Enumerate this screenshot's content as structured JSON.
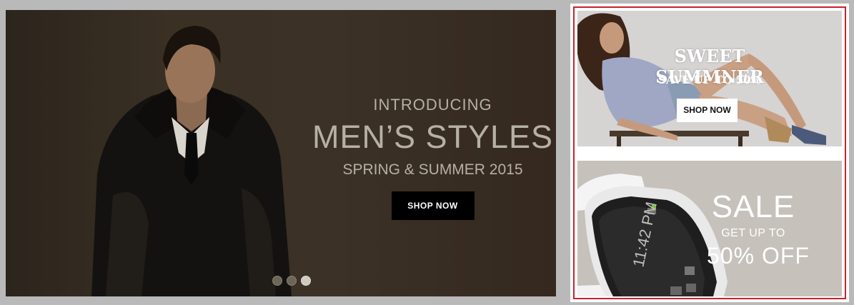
{
  "hero": {
    "intro": "INTRODUCING",
    "title": "MEN’S STYLES",
    "subtitle": "SPRING & SUMMER 2015",
    "button": "SHOP NOW",
    "slides": 3,
    "active_slide": 3
  },
  "promo_summer": {
    "title": "SWEET SUMMNER",
    "subtitle": "SAVE UP TO 50%",
    "button": "SHOP NOW"
  },
  "promo_sale": {
    "title": "SALE",
    "subtitle": "GET UP TO",
    "discount": "50% OFF",
    "watch_time": "11:42 PM"
  },
  "colors": {
    "accent_border": "#c8232c",
    "button_dark": "#000000",
    "page_bg": "#b9b9b9"
  }
}
